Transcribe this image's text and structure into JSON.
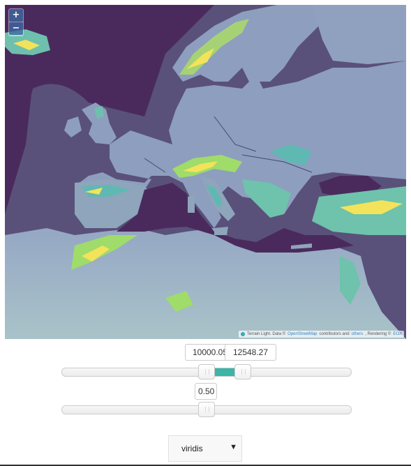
{
  "map": {
    "zoom_in_label": "+",
    "zoom_out_label": "−",
    "attribution": {
      "prefix": "Terrain Light. Data ©",
      "osm_link": "OpenStreetMap",
      "middle": "contributors and",
      "others_link": "others",
      "suffix": ", Rendering ©",
      "eox_link": "EOX"
    },
    "colors": {
      "water": "#4a2a5c",
      "shelf": "#5a5a7e",
      "lowland": "#8a9cbc",
      "midland": "#5fb9b2",
      "highland": "#9fdc6a",
      "peak": "#f2e35a"
    }
  },
  "elevation_range": {
    "min_value": "10000.05",
    "max_value": "12548.27",
    "accent_color": "#3bb5a7"
  },
  "opacity": {
    "value": "0.50",
    "fraction": 0.5
  },
  "colormap": {
    "selected": "viridis",
    "arrow": "▼"
  }
}
